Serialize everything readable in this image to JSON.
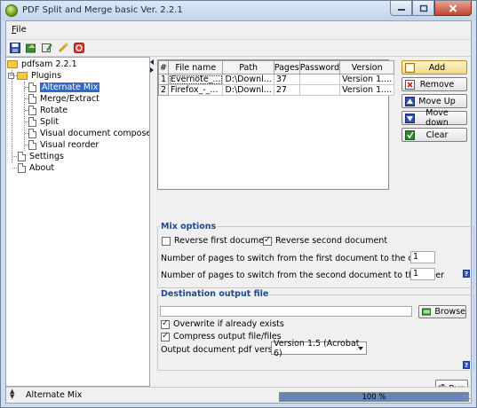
{
  "window": {
    "title": "PDF Split and Merge basic Ver. 2.2.1",
    "controls": [
      "minimize",
      "maximize",
      "close"
    ]
  },
  "menu": {
    "file_label": "File"
  },
  "toolbar": {
    "icons": [
      "save-icon",
      "open-icon",
      "clear-icon",
      "settings-icon",
      "exit-icon"
    ]
  },
  "tree": {
    "root": "pdfsam 2.2.1",
    "plugins_label": "Plugins",
    "plugins": [
      "Alternate Mix",
      "Merge/Extract",
      "Rotate",
      "Split",
      "Visual document composer",
      "Visual reorder"
    ],
    "selected": "Alternate Mix",
    "settings_label": "Settings",
    "about_label": "About"
  },
  "file_table": {
    "columns": [
      "#",
      "File name",
      "Path",
      "Pages",
      "Password",
      "Version"
    ],
    "rows": [
      {
        "index": "1",
        "file_name": "Evernote_...",
        "path": "D:\\Downl...",
        "pages": "37",
        "password": "",
        "version": "Version 1...."
      },
      {
        "index": "2",
        "file_name": "Firefox_-_...",
        "path": "D:\\Downl...",
        "pages": "27",
        "password": "",
        "version": "Version 1...."
      }
    ]
  },
  "buttons": {
    "add": "Add",
    "remove": "Remove",
    "move_up": "Move Up",
    "move_down": "Move down",
    "clear": "Clear",
    "browse": "Browse",
    "run": "Run"
  },
  "mix_options": {
    "title": "Mix options",
    "reverse_first": {
      "label": "Reverse first document",
      "checked": false
    },
    "reverse_second": {
      "label": "Reverse second document",
      "checked": true
    },
    "switch_first_label": "Number of pages to switch from the first document to the other",
    "switch_first_value": "1",
    "switch_second_label": "Number of pages to switch from the second document to the other",
    "switch_second_value": "1"
  },
  "destination": {
    "title": "Destination output file",
    "path_value": "",
    "overwrite": {
      "label": "Overwrite if already exists",
      "checked": true
    },
    "compress": {
      "label": "Compress output file/files",
      "checked": true
    },
    "version_label": "Output document pdf version:",
    "version_value": "Version 1.5 (Acrobat 6)"
  },
  "help_label": "?",
  "status": {
    "plugin": "Alternate Mix",
    "progress_text": "100 %",
    "progress_fraction": 1.0
  },
  "colors": {
    "accent": "#3169c6",
    "group_title": "#1d4a90",
    "progress": "#6683ba"
  }
}
